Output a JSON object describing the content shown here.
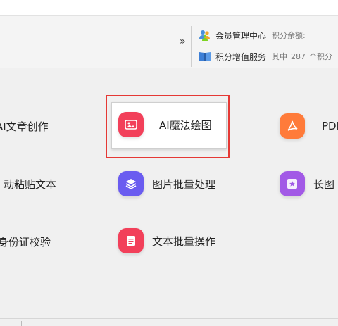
{
  "toolbar": {
    "more_chevron": "»",
    "member_center": {
      "icon": "users-icon",
      "label": "会员管理中心",
      "points_balance_label": "积分余额:"
    },
    "points_service": {
      "icon": "book-icon",
      "label": "积分增值服务",
      "detail_prefix": "其中",
      "detail_count": "287",
      "detail_suffix": "个积分"
    }
  },
  "tools": [
    {
      "label": "AI文章创作",
      "icon": ""
    },
    {
      "label": "AI魔法绘图",
      "icon": "magic-image-icon",
      "icon_color": "#f2405a",
      "highlighted": true
    },
    {
      "label": "PDF",
      "icon": "pdf-icon",
      "icon_color": "#ff7b3a"
    },
    {
      "label": "动粘贴文本",
      "icon": ""
    },
    {
      "label": "图片批量处理",
      "icon": "layers-icon",
      "icon_color": "#6a5cf0"
    },
    {
      "label": "长图",
      "icon": "long-image-icon",
      "icon_color": "#a259e6"
    },
    {
      "label": "身份证校验",
      "icon": ""
    },
    {
      "label": "文本批量操作",
      "icon": "document-icon",
      "icon_color": "#f2405a"
    }
  ],
  "colors": {
    "highlight_border": "#e53935",
    "background": "#f0f0f0"
  }
}
